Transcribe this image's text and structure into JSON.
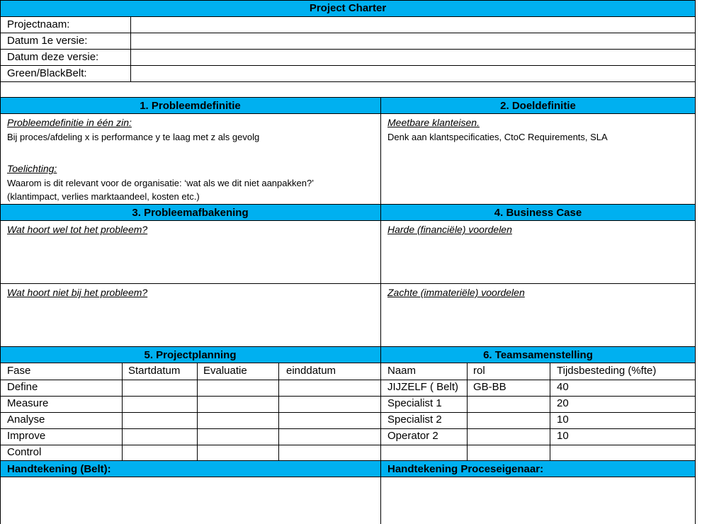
{
  "header": {
    "title": "Project Charter",
    "fields": [
      {
        "label": "Projectnaam:",
        "value": ""
      },
      {
        "label": "Datum 1e versie:",
        "value": ""
      },
      {
        "label": "Datum deze versie:",
        "value": ""
      },
      {
        "label": "Green/BlackBelt:",
        "value": ""
      }
    ]
  },
  "sections": {
    "probleemdefinitie": {
      "title": "1. Probleemdefinitie",
      "sub1": "Probleemdefinitie in één zin:",
      "text1": "Bij proces/afdeling x is performance y te laag met z als gevolg",
      "sub2": "Toelichting:",
      "text2a": "Waarom is dit relevant voor de organisatie: ‘wat als we dit niet aanpakken?’",
      "text2b": "(klantimpact, verlies marktaandeel, kosten etc.)"
    },
    "doeldefinitie": {
      "title": "2. Doeldefinitie",
      "sub1": "Meetbare klanteisen.",
      "text1": "Denk  aan klantspecificaties, CtoC Requirements, SLA"
    },
    "probleemafbakening": {
      "title": "3. Probleemafbakening",
      "sub1": "Wat hoort wel tot het probleem?",
      "sub2": "Wat hoort niet bij het probleem?"
    },
    "business_case": {
      "title": "4. Business Case",
      "sub1": "Harde (financiële) voordelen",
      "sub2": "Zachte (immateriële) voordelen"
    },
    "projectplanning": {
      "title": "5. Projectplanning",
      "columns": [
        "Fase",
        "Startdatum",
        "Evaluatie",
        "einddatum"
      ],
      "rows": [
        "Define",
        "Measure",
        "Analyse",
        "Improve",
        "Control"
      ]
    },
    "teamsamenstelling": {
      "title": "6. Teamsamenstelling",
      "columns": [
        "Naam",
        "rol",
        "Tijdsbesteding (%fte)"
      ],
      "rows": [
        {
          "naam": "JIJZELF ( Belt)",
          "rol": "GB-BB",
          "tijd": "40"
        },
        {
          "naam": "Specialist 1",
          "rol": "",
          "tijd": "20"
        },
        {
          "naam": "Specialist 2",
          "rol": "",
          "tijd": "10"
        },
        {
          "naam": "Operator 2",
          "rol": "",
          "tijd": "10"
        }
      ]
    },
    "handtekening_belt": {
      "title": "Handtekening (Belt):"
    },
    "handtekening_eigenaar": {
      "title": "Handtekening Proceseigenaar:"
    }
  },
  "colors": {
    "header_band": "#00b0f0",
    "grid": "#000000"
  }
}
